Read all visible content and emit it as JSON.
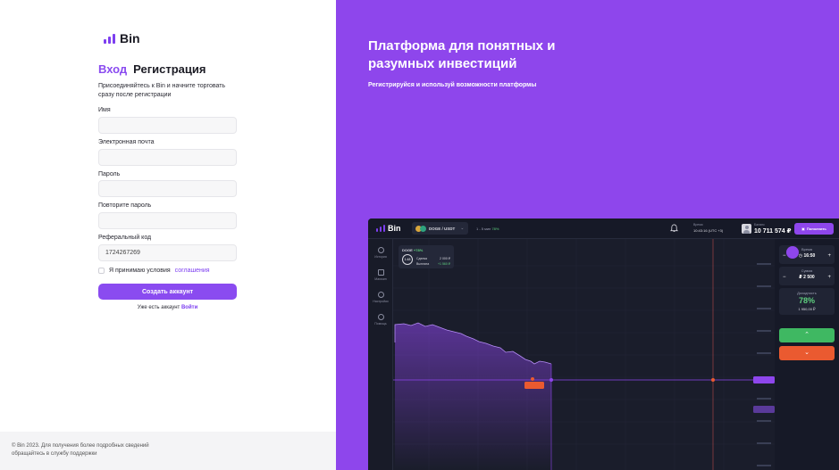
{
  "brand": {
    "name": "Bin",
    "color": "#8a4bf0"
  },
  "auth": {
    "tab_login": "Вход",
    "tab_register": "Регистрация",
    "intro": "Присоединяйтесь к Bin и начните торговать сразу после регистрации",
    "fields": [
      {
        "label": "Имя",
        "value": "",
        "placeholder": ""
      },
      {
        "label": "Электронная почта",
        "value": "",
        "placeholder": ""
      },
      {
        "label": "Пароль",
        "value": "",
        "placeholder": ""
      },
      {
        "label": "Повторите пароль",
        "value": "",
        "placeholder": ""
      },
      {
        "label": "Реферальный код",
        "value": "1724267269",
        "placeholder": ""
      }
    ],
    "agree_text": "Я принимаю условия",
    "agree_link": "соглашения",
    "submit": "Создать аккаунт",
    "have_account": "Уже есть аккаунт",
    "login_link": "Войти"
  },
  "footer": {
    "text": "© Bin 2023. Для получения более подробных сведений обращайтесь в службу поддержки"
  },
  "promo": {
    "headline": "Платформа для понятных и разумных инвестиций",
    "subhead": "Регистрируйся и используй возможности платформы"
  },
  "app": {
    "logo": "Bin",
    "pair": "DOGE / USDT",
    "payout": "1 - 5 мин",
    "payout_pct": "78%",
    "time_label": "Время",
    "time_value": "10:43:16 (UTC +3)",
    "balance_label": "Баланс",
    "balance_value": "10 711 574 ₽",
    "topup": "Пополнить",
    "side_items": [
      "История",
      "Магазин",
      "Настройки",
      "Помощь"
    ],
    "deal": {
      "title": "DOGE",
      "pct": "+78%",
      "timer": "1:48",
      "rows": [
        {
          "label": "Сделка",
          "value": "2 000 ₽"
        },
        {
          "label": "Выплата",
          "value": "+1 560 ₽"
        }
      ]
    },
    "time_box": {
      "label": "Время",
      "value": "16:50",
      "minus": "−",
      "plus": "+"
    },
    "sum_box": {
      "label": "Сумма",
      "value": "₽ 2 500",
      "minus": "−",
      "plus": "+"
    },
    "profit_box": {
      "label": "Доходность",
      "pct": "78%",
      "sum": "1 950,00 ₽"
    },
    "up_icon": "chevron-up-icon",
    "down_icon": "chevron-down-icon",
    "colors": {
      "up": "#3fb862",
      "down": "#ea5a30",
      "line": "#8e46ec",
      "marker": "#ea5a30"
    }
  }
}
